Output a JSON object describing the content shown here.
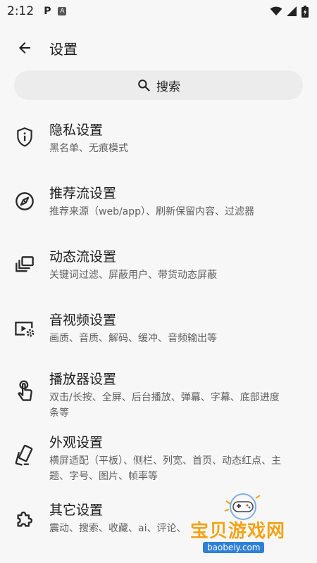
{
  "status_bar": {
    "time": "2:12",
    "notif_p": "P",
    "notif_a": "A"
  },
  "app_bar": {
    "title": "设置"
  },
  "search": {
    "label": "搜索"
  },
  "items": [
    {
      "title": "隐私设置",
      "subtitle": "黑名单、无痕模式",
      "icon": "shield-info-icon"
    },
    {
      "title": "推荐流设置",
      "subtitle": "推荐来源（web/app）、刷新保留内容、过滤器",
      "icon": "compass-icon"
    },
    {
      "title": "动态流设置",
      "subtitle": "关键词过滤、屏蔽用户、带货动态屏蔽",
      "icon": "dynamic-feed-icon"
    },
    {
      "title": "音视频设置",
      "subtitle": "画质、音质、解码、缓冲、音频输出等",
      "icon": "video-settings-icon"
    },
    {
      "title": "播放器设置",
      "subtitle": "双击/长按、全屏、后台播放、弹幕、字幕、底部进度条等",
      "icon": "touch-icon"
    },
    {
      "title": "外观设置",
      "subtitle": "横屏适配（平板）、侧栏、列宽、首页、动态红点、主题、字号、图片、帧率等",
      "icon": "devices-icon"
    },
    {
      "title": "其它设置",
      "subtitle": "震动、搜索、收藏、ai、评论、",
      "icon": "puzzle-icon"
    }
  ],
  "watermark": {
    "text": "宝贝游戏网",
    "url": "baobeiy.com"
  },
  "colors": {
    "background": "#f7f7f7",
    "search_bg": "#ececec",
    "watermark_orange": "#f4a21a",
    "watermark_blue": "#2e7fd6"
  }
}
